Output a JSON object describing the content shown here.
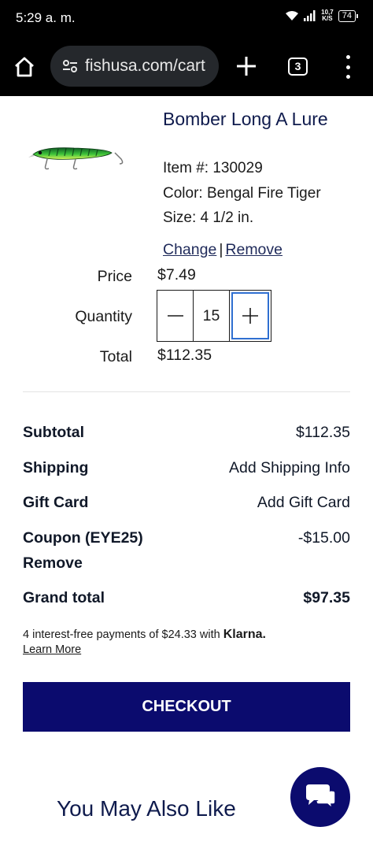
{
  "status_bar": {
    "time": "5:29 a. m.",
    "net_speed_top": "10,7",
    "net_speed_bottom": "K/S",
    "battery": "74"
  },
  "browser": {
    "url": "fishusa.com/cart",
    "tab_count": "3"
  },
  "product": {
    "title": "Bomber Long A Lure",
    "item_number": "Item #: 130029",
    "color": "Color: Bengal Fire Tiger",
    "size": "Size: 4 1/2 in.",
    "change_label": "Change",
    "separator": "|",
    "remove_label": "Remove",
    "price_label": "Price",
    "price_value": "$7.49",
    "quantity_label": "Quantity",
    "quantity_value": "15",
    "total_label": "Total",
    "total_value": "$112.35"
  },
  "summary": {
    "subtotal_label": "Subtotal",
    "subtotal_value": "$112.35",
    "shipping_label": "Shipping",
    "shipping_value": "Add Shipping Info",
    "gift_card_label": "Gift Card",
    "gift_card_value": "Add Gift Card",
    "coupon_label": "Coupon (EYE25)",
    "coupon_value": "-$15.00",
    "coupon_remove": "Remove",
    "grand_total_label": "Grand total",
    "grand_total_value": "$97.35"
  },
  "klarna": {
    "text": "4 interest-free payments of $24.33 with ",
    "brand": "Klarna.",
    "learn_more": "Learn More"
  },
  "checkout_label": "CHECKOUT",
  "recommendations_title": "You May Also Like",
  "colors": {
    "brand_navy": "#0b0b6e",
    "focus_blue": "#2f6fd1"
  }
}
